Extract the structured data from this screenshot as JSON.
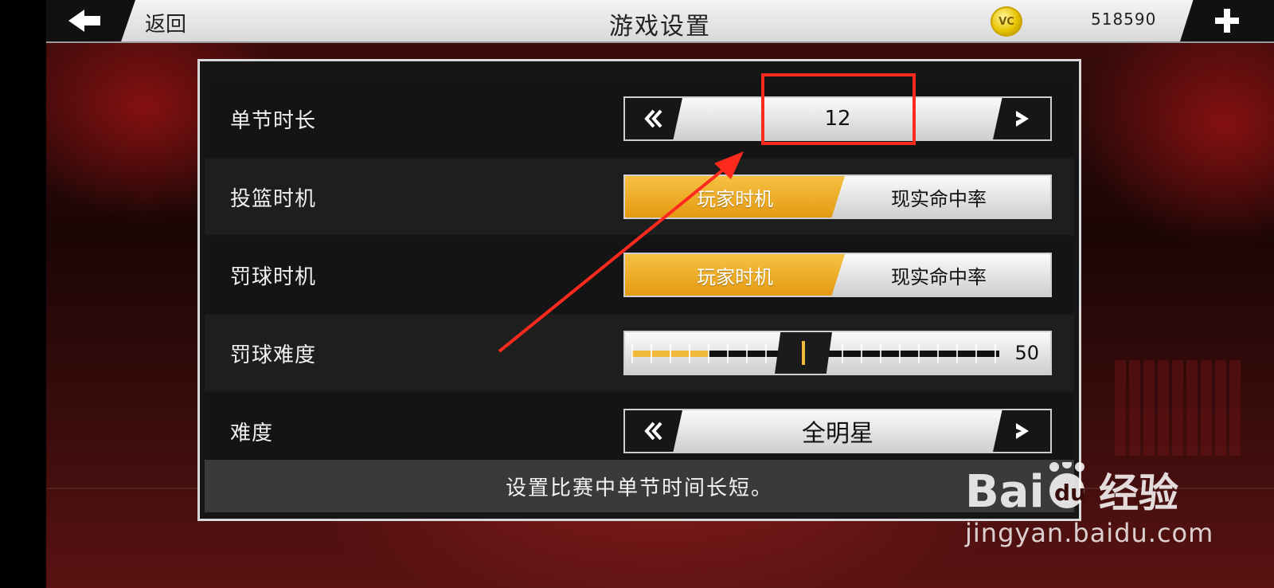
{
  "header": {
    "back_label": "返回",
    "title": "游戏设置",
    "currency_icon": "VC",
    "currency_amount": "518590"
  },
  "settings": [
    {
      "label": "单节时长",
      "type": "stepper",
      "value": "12"
    },
    {
      "label": "投篮时机",
      "type": "toggle",
      "options": [
        "玩家时机",
        "现实命中率"
      ],
      "selected": 0
    },
    {
      "label": "罚球时机",
      "type": "toggle",
      "options": [
        "玩家时机",
        "现实命中率"
      ],
      "selected": 0
    },
    {
      "label": "罚球难度",
      "type": "slider",
      "value": "50",
      "min": 0,
      "max": 100
    },
    {
      "label": "难度",
      "type": "stepper",
      "value": "全明星"
    }
  ],
  "description": "设置比赛中单节时间长短。",
  "watermark": {
    "brand": "Baidu 经验",
    "url": "jingyan.baidu.com"
  },
  "colors": {
    "accent": "#F0B93A",
    "annotation": "#FF2A1E"
  }
}
